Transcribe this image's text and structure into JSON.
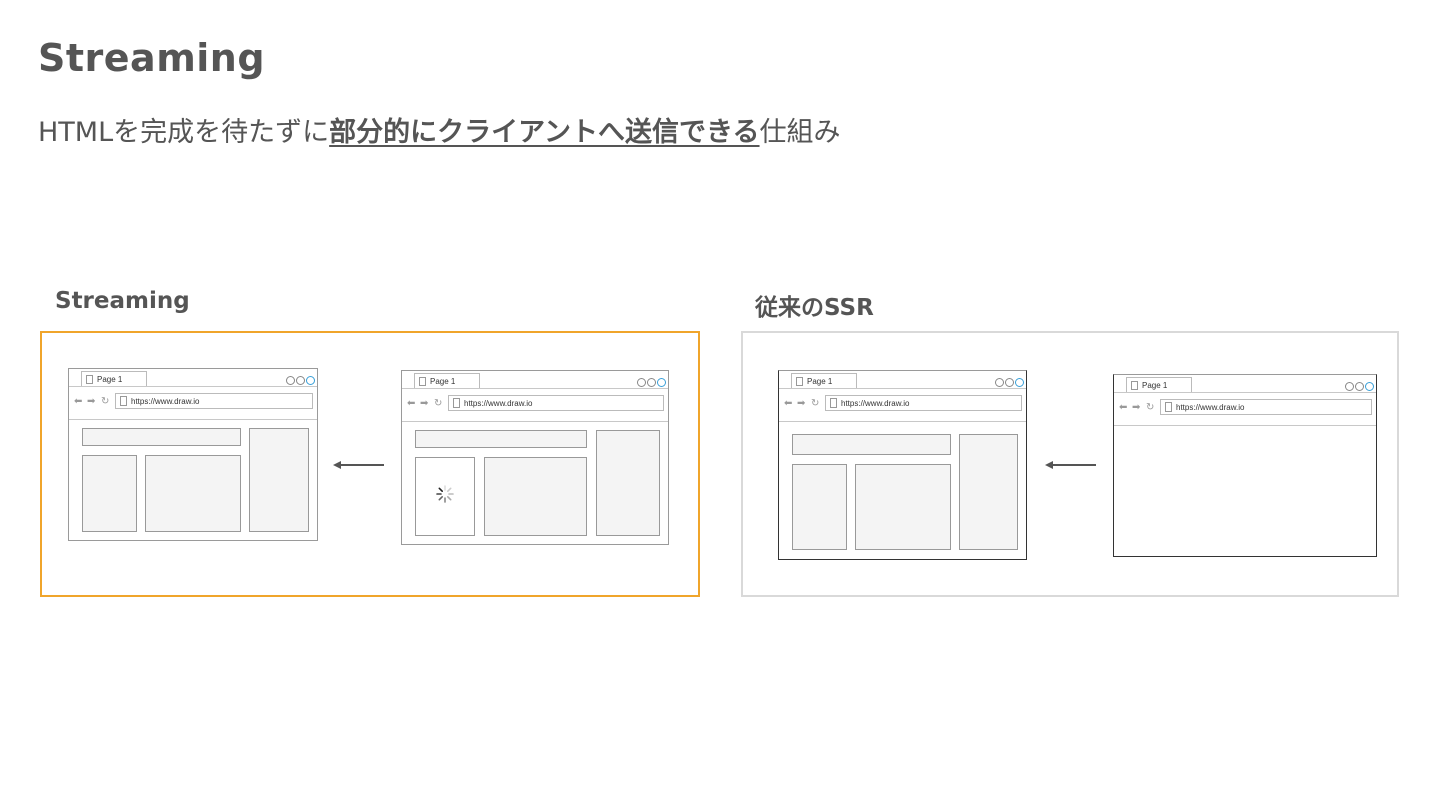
{
  "slide": {
    "title": "Streaming",
    "subtitle_pre": "HTMLを完成を待たずに",
    "subtitle_emphasis": "部分的にクライアントへ送信できる",
    "subtitle_post": "仕組み"
  },
  "panels": {
    "streaming": {
      "title": "Streaming",
      "accent": "#f0a52b"
    },
    "ssr": {
      "title": "従来のSSR",
      "border": "#d9d9d9"
    }
  },
  "browser": {
    "tab_label": "Page 1",
    "url": "https://www.draw.io"
  },
  "icons": {
    "back": "back-arrow-icon",
    "forward": "forward-arrow-icon",
    "reload": "reload-icon",
    "loading": "loading-spinner-icon",
    "flow_arrow": "left-arrow-icon"
  }
}
